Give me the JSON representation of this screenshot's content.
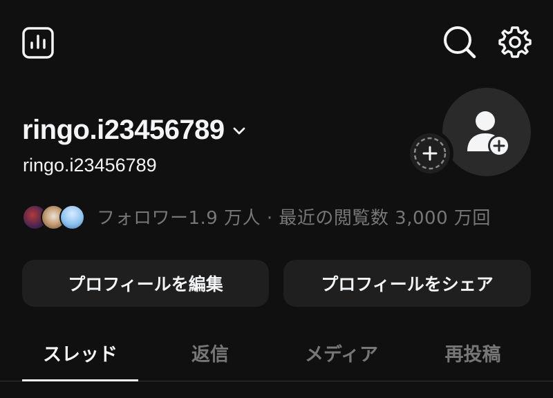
{
  "header": {
    "insights_icon": "bar-chart-icon",
    "search_icon": "search-icon",
    "settings_icon": "gear-icon"
  },
  "profile": {
    "username": "ringo.i23456789",
    "handle": "ringo.i23456789",
    "switcher_icon": "chevron-down-icon",
    "followers_text": "フォロワー1.9 万人 · 最近の閲覧数 3,000 万回",
    "avatar_icon": "person-add-icon",
    "add_story_icon": "plus-icon"
  },
  "actions": {
    "edit_label": "プロフィールを編集",
    "share_label": "プロフィールをシェア"
  },
  "tabs": [
    {
      "label": "スレッド",
      "active": true
    },
    {
      "label": "返信",
      "active": false
    },
    {
      "label": "メディア",
      "active": false
    },
    {
      "label": "再投稿",
      "active": false
    }
  ],
  "colors": {
    "background": "#101010",
    "text_primary": "#f3f5f7",
    "text_secondary": "#777777",
    "button_bg": "#1f1f1f"
  }
}
